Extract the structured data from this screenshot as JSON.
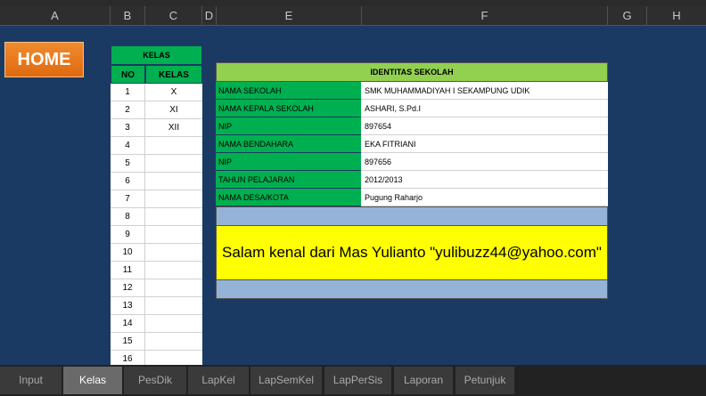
{
  "columns": [
    "A",
    "B",
    "C",
    "D",
    "E",
    "F",
    "G",
    "H"
  ],
  "home_label": "HOME",
  "kelas": {
    "title": "KELAS",
    "headers": {
      "no": "NO",
      "kelas": "KELAS"
    },
    "rows": [
      {
        "no": "1",
        "kelas": "X"
      },
      {
        "no": "2",
        "kelas": "XI"
      },
      {
        "no": "3",
        "kelas": "XII"
      },
      {
        "no": "4",
        "kelas": ""
      },
      {
        "no": "5",
        "kelas": ""
      },
      {
        "no": "6",
        "kelas": ""
      },
      {
        "no": "7",
        "kelas": ""
      },
      {
        "no": "8",
        "kelas": ""
      },
      {
        "no": "9",
        "kelas": ""
      },
      {
        "no": "10",
        "kelas": ""
      },
      {
        "no": "11",
        "kelas": ""
      },
      {
        "no": "12",
        "kelas": ""
      },
      {
        "no": "13",
        "kelas": ""
      },
      {
        "no": "14",
        "kelas": ""
      },
      {
        "no": "15",
        "kelas": ""
      },
      {
        "no": "16",
        "kelas": ""
      }
    ]
  },
  "identitas": {
    "title": "IDENTITAS SEKOLAH",
    "rows": [
      {
        "label": "NAMA SEKOLAH",
        "value": "SMK MUHAMMADIYAH I SEKAMPUNG UDIK"
      },
      {
        "label": "NAMA KEPALA SEKOLAH",
        "value": "ASHARI, S.Pd.I"
      },
      {
        "label": "NIP",
        "value": "897654"
      },
      {
        "label": "NAMA BENDAHARA",
        "value": "EKA FITRIANI"
      },
      {
        "label": "NIP",
        "value": "897656"
      },
      {
        "label": "TAHUN PELAJARAN",
        "value": "2012/2013"
      },
      {
        "label": "NAMA DESA/KOTA",
        "value": "Pugung Raharjo"
      }
    ],
    "message": "Salam kenal dari Mas Yulianto \"yulibuzz44@yahoo.com\""
  },
  "tabs": [
    {
      "label": "Input",
      "active": false
    },
    {
      "label": "Kelas",
      "active": true
    },
    {
      "label": "PesDik",
      "active": false
    },
    {
      "label": "LapKel",
      "active": false
    },
    {
      "label": "LapSemKel",
      "active": false
    },
    {
      "label": "LapPerSis",
      "active": false
    },
    {
      "label": "Laporan",
      "active": false
    },
    {
      "label": "Petunjuk",
      "active": false
    }
  ]
}
